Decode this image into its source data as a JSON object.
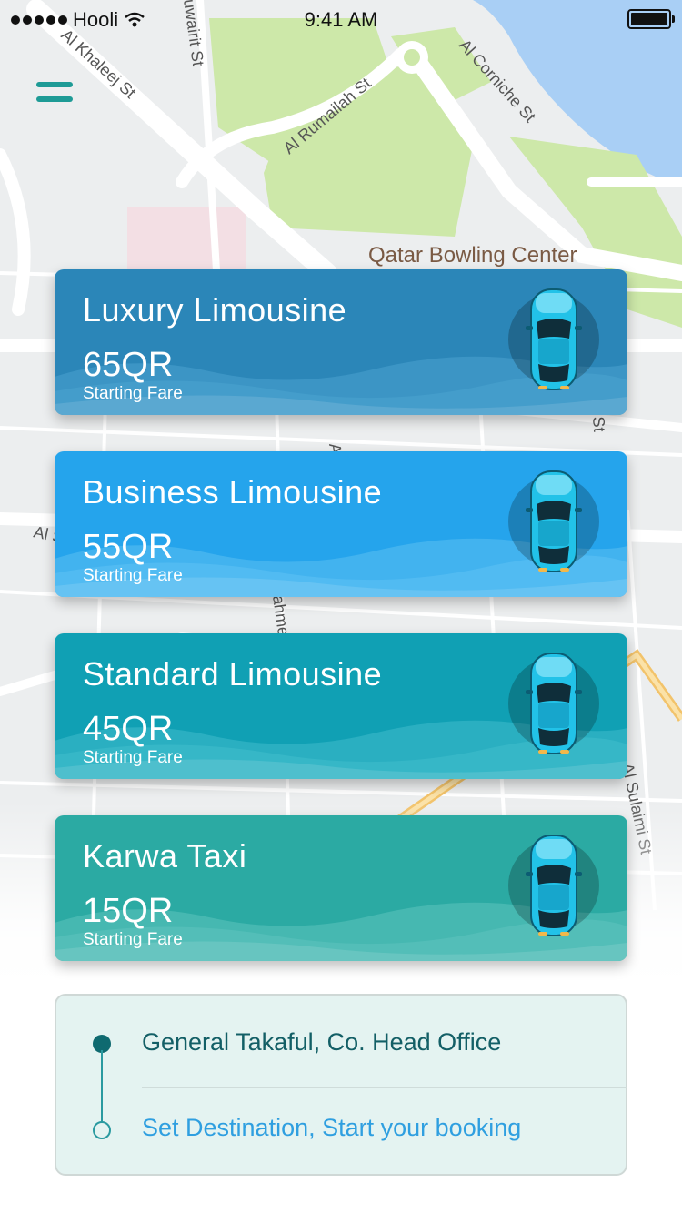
{
  "status_bar": {
    "carrier": "Hooli",
    "time": "9:41 AM"
  },
  "map": {
    "labels": {
      "al_khaleej": "Al Khaleej St",
      "kuwairit": "uwairit St",
      "al_rumailah": "Al Rumailah St",
      "al_corniche": "Al Corniche St",
      "bowling": "Qatar Bowling Center",
      "al_sulaimi": "Al Sulaimi St",
      "al_left": "Al S",
      "st_right": "St",
      "ahmed": "ahme",
      "a_mid": "A"
    }
  },
  "cars": [
    {
      "name": "Luxury Limousine",
      "price": "65QR",
      "fare_label": "Starting Fare",
      "color": "#2b86b8",
      "wave": "#4aa3cf"
    },
    {
      "name": "Business Limousine",
      "price": "55QR",
      "fare_label": "Starting Fare",
      "color": "#25a4ec",
      "wave": "#5bc0f3"
    },
    {
      "name": "Standard Limousine",
      "price": "45QR",
      "fare_label": "Starting Fare",
      "color": "#10a0b4",
      "wave": "#3fbccc"
    },
    {
      "name": "Karwa Taxi",
      "price": "15QR",
      "fare_label": "Starting Fare",
      "color": "#2baaa3",
      "wave": "#5cc2bd"
    }
  ],
  "destination": {
    "pickup": "General Takaful, Co. Head Office",
    "dropoff": "Set Destination, Start your booking"
  },
  "colors": {
    "accent": "#1e9b96",
    "pickup_text": "#135f66",
    "dropoff_text": "#2f9fe0"
  }
}
